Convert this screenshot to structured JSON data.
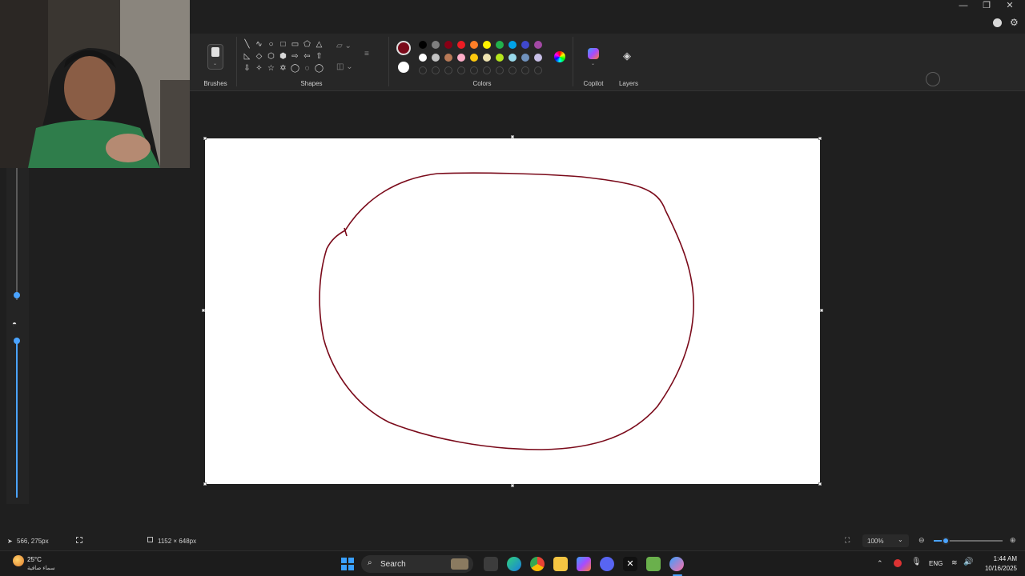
{
  "window": {
    "minimize_glyph": "—",
    "restore_glyph": "❐",
    "close_glyph": "✕"
  },
  "ribbon": {
    "groups": {
      "brushes": "Brushes",
      "shapes": "Shapes",
      "colors": "Colors",
      "copilot": "Copilot",
      "layers": "Layers"
    },
    "shape_glyphs": [
      "╲",
      "∿",
      "○",
      "□",
      "▭",
      "⬠",
      "△",
      "◺",
      "◇",
      "⬡",
      "⬢",
      "⇨",
      "⇦",
      "⇧",
      "⇩",
      "✧",
      "☆",
      "✡",
      "◯",
      "◌",
      "◯"
    ],
    "primary_color": "#7a0a1a",
    "secondary_color": "#ffffff",
    "palette_row1": [
      "#000000",
      "#7f7f7f",
      "#880015",
      "#ed1c24",
      "#ff7f27",
      "#fff200",
      "#22b14c",
      "#00a2e8",
      "#3f48cc",
      "#a349a4"
    ],
    "palette_row2": [
      "#ffffff",
      "#c3c3c3",
      "#b97a57",
      "#ffaec9",
      "#ffc90e",
      "#efe4b0",
      "#b5e61d",
      "#99d9ea",
      "#7092be",
      "#c8bfe7"
    ]
  },
  "canvas": {
    "stroke_color": "#7a0a1a"
  },
  "status": {
    "cursor_pos": "566, 275px",
    "canvas_size": "1152 × 648px",
    "zoom": "100%",
    "zoom_level": 0.5
  },
  "taskbar": {
    "weather_temp": "25°C",
    "weather_desc": "سماء صافية",
    "search_label": "Search",
    "language": "ENG",
    "time": "1:44 AM",
    "date": "10/16/2025"
  }
}
